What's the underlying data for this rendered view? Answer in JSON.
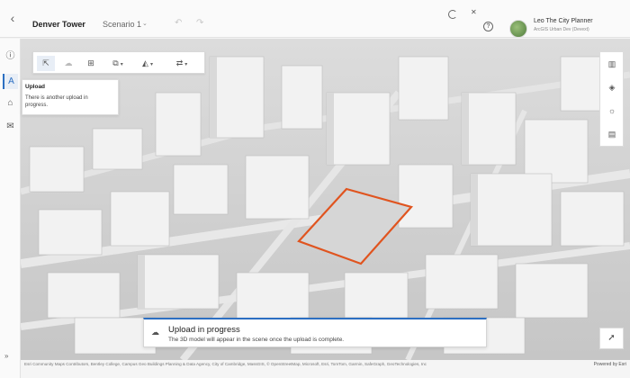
{
  "header": {
    "back_icon": "chevron-left-icon",
    "project": "Denver Tower",
    "scenario": "Scenario 1",
    "user_name": "Leo The City Planner",
    "user_org": "ArcGIS Urban Dev (Devext)"
  },
  "toolbar": {
    "tools": [
      {
        "name": "select-icon",
        "glyph": "⇱"
      },
      {
        "name": "upload-icon",
        "glyph": "☁"
      },
      {
        "name": "layers-edit-icon",
        "glyph": "⊞"
      },
      {
        "name": "cube-icon",
        "glyph": "⧉"
      },
      {
        "name": "shapes-icon",
        "glyph": "◭"
      },
      {
        "name": "measure-icon",
        "glyph": "⇄"
      }
    ]
  },
  "tooltip": {
    "title": "Upload",
    "body": "There is another upload in progress."
  },
  "banner": {
    "title": "Upload in progress",
    "body": "The 3D model will appear in the scene once the upload is complete."
  },
  "attribution": {
    "text": "Esri Community Maps Contributors, Bentley College, Campus Geo Buildings Planning & Data Agency, City of Cambridge, MassGIS, © OpenStreetMap, Microsoft, Esri, TomTom, Garmin, SafeGraph, GeoTechnologies, Inc",
    "powered": "Powered by Esri"
  },
  "colors": {
    "accent": "#2c6fc2",
    "highlight": "#e0541f"
  }
}
